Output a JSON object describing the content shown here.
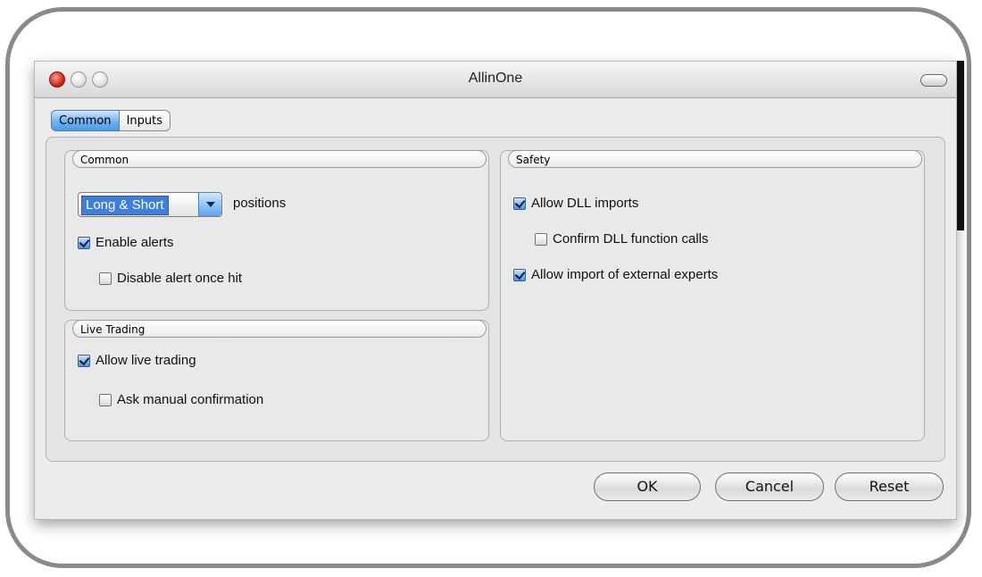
{
  "window": {
    "title": "AllinOne"
  },
  "tabs": [
    {
      "label": "Common",
      "active": true
    },
    {
      "label": "Inputs",
      "active": false
    }
  ],
  "common_group": {
    "title": "Common",
    "position_select": {
      "selected": "Long & Short",
      "suffix": "positions"
    },
    "enable_alerts": {
      "label": "Enable alerts",
      "checked": true
    },
    "disable_alert_once_hit": {
      "label": "Disable alert once hit",
      "checked": false
    }
  },
  "live_trading_group": {
    "title": "Live Trading",
    "allow_live_trading": {
      "label": "Allow live trading",
      "checked": true
    },
    "ask_manual_confirmation": {
      "label": "Ask manual confirmation",
      "checked": false
    }
  },
  "safety_group": {
    "title": "Safety",
    "allow_dll_imports": {
      "label": "Allow DLL imports",
      "checked": true
    },
    "confirm_dll_function_calls": {
      "label": "Confirm DLL function calls",
      "checked": false
    },
    "allow_import_external_experts": {
      "label": "Allow import of external experts",
      "checked": true
    }
  },
  "buttons": {
    "ok": "OK",
    "cancel": "Cancel",
    "reset": "Reset"
  },
  "colors": {
    "accent": "#4d9ae8",
    "selection": "#3d7fdb",
    "close_button": "#d6281a"
  }
}
